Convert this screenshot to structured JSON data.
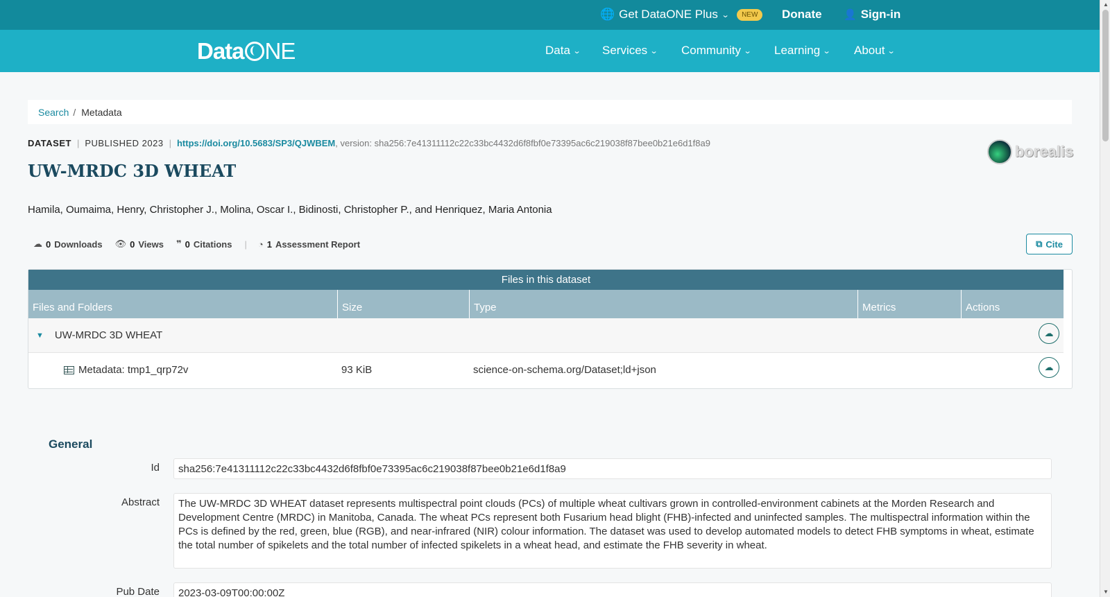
{
  "topbar": {
    "plus_label": "Get DataONE Plus",
    "new_badge": "NEW",
    "donate": "Donate",
    "signin": "Sign-in"
  },
  "nav": {
    "logo": "DataONE",
    "items": [
      "Data",
      "Services",
      "Community",
      "Learning",
      "About"
    ]
  },
  "breadcrumb": {
    "search": "Search",
    "separator": "/",
    "current": "Metadata"
  },
  "dataset": {
    "type_label": "DATASET",
    "published": "PUBLISHED 2023",
    "doi": "https://doi.org/10.5683/SP3/QJWBEM",
    "version": ", version: sha256:7e41311112c22c33bc4432d6f8fbf0e73395ac6c219038f87bee0b21e6d1f8a9",
    "title": "UW-MRDC 3D WHEAT",
    "authors": "Hamila, Oumaima, Henry, Christopher J., Molina, Oscar I., Bidinosti, Christopher P., and Henriquez, Maria Antonia",
    "repository": "borealis"
  },
  "stats": {
    "downloads_count": "0",
    "downloads_label": "Downloads",
    "views_count": "0",
    "views_label": "Views",
    "citations_count": "0",
    "citations_label": "Citations",
    "assessment_count": "1",
    "assessment_label": "Assessment Report",
    "cite_button": "Cite"
  },
  "files": {
    "header": "Files in this dataset",
    "columns": [
      "Files and Folders",
      "Size",
      "Type",
      "Metrics",
      "Actions"
    ],
    "rows": [
      {
        "name": "UW-MRDC 3D WHEAT",
        "size": "",
        "type": ""
      },
      {
        "name": "Metadata: tmp1_qrp72v",
        "size": "93 KiB",
        "type": "science-on-schema.org/Dataset;ld+json"
      }
    ]
  },
  "general": {
    "heading": "General",
    "id_label": "Id",
    "id_value": "sha256:7e41311112c22c33bc4432d6f8fbf0e73395ac6c219038f87bee0b21e6d1f8a9",
    "abstract_label": "Abstract",
    "abstract_value": "The UW-MRDC 3D WHEAT dataset represents multispectral point clouds (PCs) of multiple wheat cultivars grown in controlled-environment cabinets at the Morden Research and Development Centre (MRDC) in Manitoba, Canada. The wheat PCs represent both Fusarium head blight (FHB)-infected and uninfected samples. The multispectral information within the PCs is defined by the red, green, blue (RGB), and near-infrared (NIR) colour information. The dataset was used to develop automated models to detect FHB symptoms in wheat, estimate the total number of spikelets and the total number of infected spikelets in a wheat head, and estimate the FHB severity in wheat.",
    "pubdate_label": "Pub Date",
    "pubdate_value": "2023-03-09T00:00:00Z"
  }
}
